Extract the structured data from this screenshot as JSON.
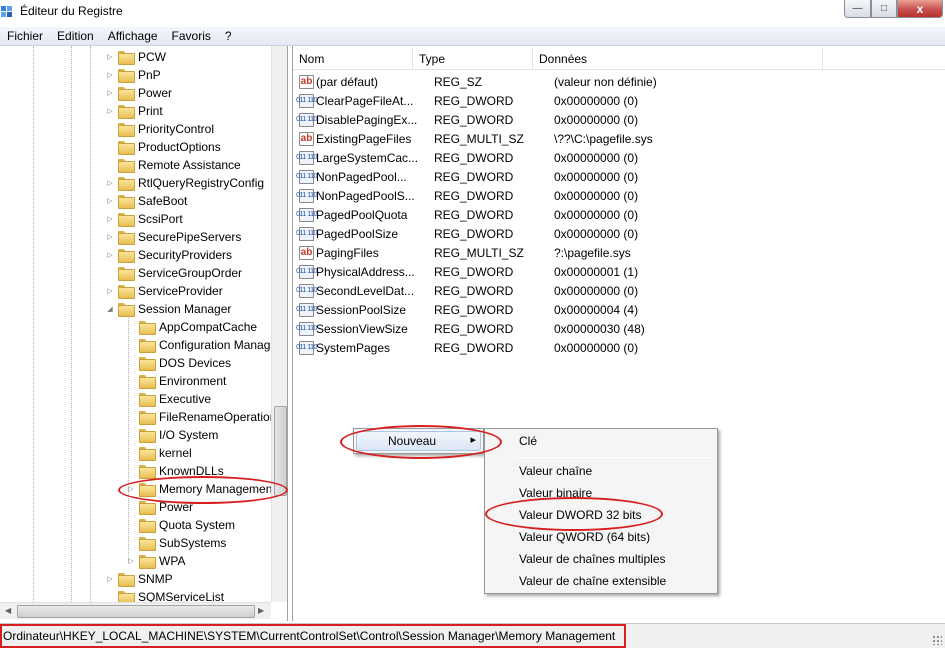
{
  "window": {
    "title": "Éditeur du Registre",
    "close": "x",
    "minimize": "—",
    "maximize": "□"
  },
  "menubar": [
    "Fichier",
    "Edition",
    "Affichage",
    "Favoris",
    "?"
  ],
  "tree": [
    {
      "label": "PCW",
      "arrow": "▷"
    },
    {
      "label": "PnP",
      "arrow": "▷"
    },
    {
      "label": "Power",
      "arrow": "▷"
    },
    {
      "label": "Print",
      "arrow": "▷"
    },
    {
      "label": "PriorityControl",
      "arrow": ""
    },
    {
      "label": "ProductOptions",
      "arrow": ""
    },
    {
      "label": "Remote Assistance",
      "arrow": ""
    },
    {
      "label": "RtlQueryRegistryConfig",
      "arrow": "▷"
    },
    {
      "label": "SafeBoot",
      "arrow": "▷"
    },
    {
      "label": "ScsiPort",
      "arrow": "▷"
    },
    {
      "label": "SecurePipeServers",
      "arrow": "▷"
    },
    {
      "label": "SecurityProviders",
      "arrow": "▷"
    },
    {
      "label": "ServiceGroupOrder",
      "arrow": ""
    },
    {
      "label": "ServiceProvider",
      "arrow": "▷"
    },
    {
      "label": "Session Manager",
      "arrow": "◢"
    },
    {
      "label": "AppCompatCache",
      "arrow": ""
    },
    {
      "label": "Configuration Manag",
      "arrow": ""
    },
    {
      "label": "DOS Devices",
      "arrow": ""
    },
    {
      "label": "Environment",
      "arrow": ""
    },
    {
      "label": "Executive",
      "arrow": ""
    },
    {
      "label": "FileRenameOperation",
      "arrow": ""
    },
    {
      "label": "I/O System",
      "arrow": ""
    },
    {
      "label": "kernel",
      "arrow": ""
    },
    {
      "label": "KnownDLLs",
      "arrow": ""
    },
    {
      "label": "Memory Managemen",
      "arrow": "▷"
    },
    {
      "label": "Power",
      "arrow": ""
    },
    {
      "label": "Quota System",
      "arrow": ""
    },
    {
      "label": "SubSystems",
      "arrow": ""
    },
    {
      "label": "WPA",
      "arrow": "▷"
    },
    {
      "label": "SNMP",
      "arrow": "▷"
    },
    {
      "label": "SQMServiceList",
      "arrow": ""
    }
  ],
  "list": {
    "headers": [
      "Nom",
      "Type",
      "Données"
    ],
    "rows": [
      {
        "icon": "ab",
        "name": "(par défaut)",
        "type": "REG_SZ",
        "data": "(valeur non définie)"
      },
      {
        "icon": "bin",
        "name": "ClearPageFileAt...",
        "type": "REG_DWORD",
        "data": "0x00000000 (0)"
      },
      {
        "icon": "bin",
        "name": "DisablePagingEx...",
        "type": "REG_DWORD",
        "data": "0x00000000 (0)"
      },
      {
        "icon": "ab",
        "name": "ExistingPageFiles",
        "type": "REG_MULTI_SZ",
        "data": "\\??\\C:\\pagefile.sys"
      },
      {
        "icon": "bin",
        "name": "LargeSystemCac...",
        "type": "REG_DWORD",
        "data": "0x00000000 (0)"
      },
      {
        "icon": "bin",
        "name": "NonPagedPool...",
        "type": "REG_DWORD",
        "data": "0x00000000 (0)"
      },
      {
        "icon": "bin",
        "name": "NonPagedPoolS...",
        "type": "REG_DWORD",
        "data": "0x00000000 (0)"
      },
      {
        "icon": "bin",
        "name": "PagedPoolQuota",
        "type": "REG_DWORD",
        "data": "0x00000000 (0)"
      },
      {
        "icon": "bin",
        "name": "PagedPoolSize",
        "type": "REG_DWORD",
        "data": "0x00000000 (0)"
      },
      {
        "icon": "ab",
        "name": "PagingFiles",
        "type": "REG_MULTI_SZ",
        "data": "?:\\pagefile.sys"
      },
      {
        "icon": "bin",
        "name": "PhysicalAddress...",
        "type": "REG_DWORD",
        "data": "0x00000001 (1)"
      },
      {
        "icon": "bin",
        "name": "SecondLevelDat...",
        "type": "REG_DWORD",
        "data": "0x00000000 (0)"
      },
      {
        "icon": "bin",
        "name": "SessionPoolSize",
        "type": "REG_DWORD",
        "data": "0x00000004 (4)"
      },
      {
        "icon": "bin",
        "name": "SessionViewSize",
        "type": "REG_DWORD",
        "data": "0x00000030 (48)"
      },
      {
        "icon": "bin",
        "name": "SystemPages",
        "type": "REG_DWORD",
        "data": "0x00000000 (0)"
      }
    ]
  },
  "context_menu": {
    "nouveau": "Nouveau",
    "arrow": "▸"
  },
  "submenu": {
    "cle": "Clé",
    "chaine": "Valeur chaîne",
    "binaire": "Valeur binaire",
    "dword": "Valeur DWORD 32 bits",
    "qword": "Valeur QWORD (64 bits)",
    "multi": "Valeur de chaînes multiples",
    "extensible": "Valeur de chaîne extensible"
  },
  "status": {
    "path": "Ordinateur\\HKEY_LOCAL_MACHINE\\SYSTEM\\CurrentControlSet\\Control\\Session Manager\\Memory Management"
  },
  "colors": {
    "annotation": "#d81f1f",
    "menu_highlight": "#dbe6f5"
  }
}
